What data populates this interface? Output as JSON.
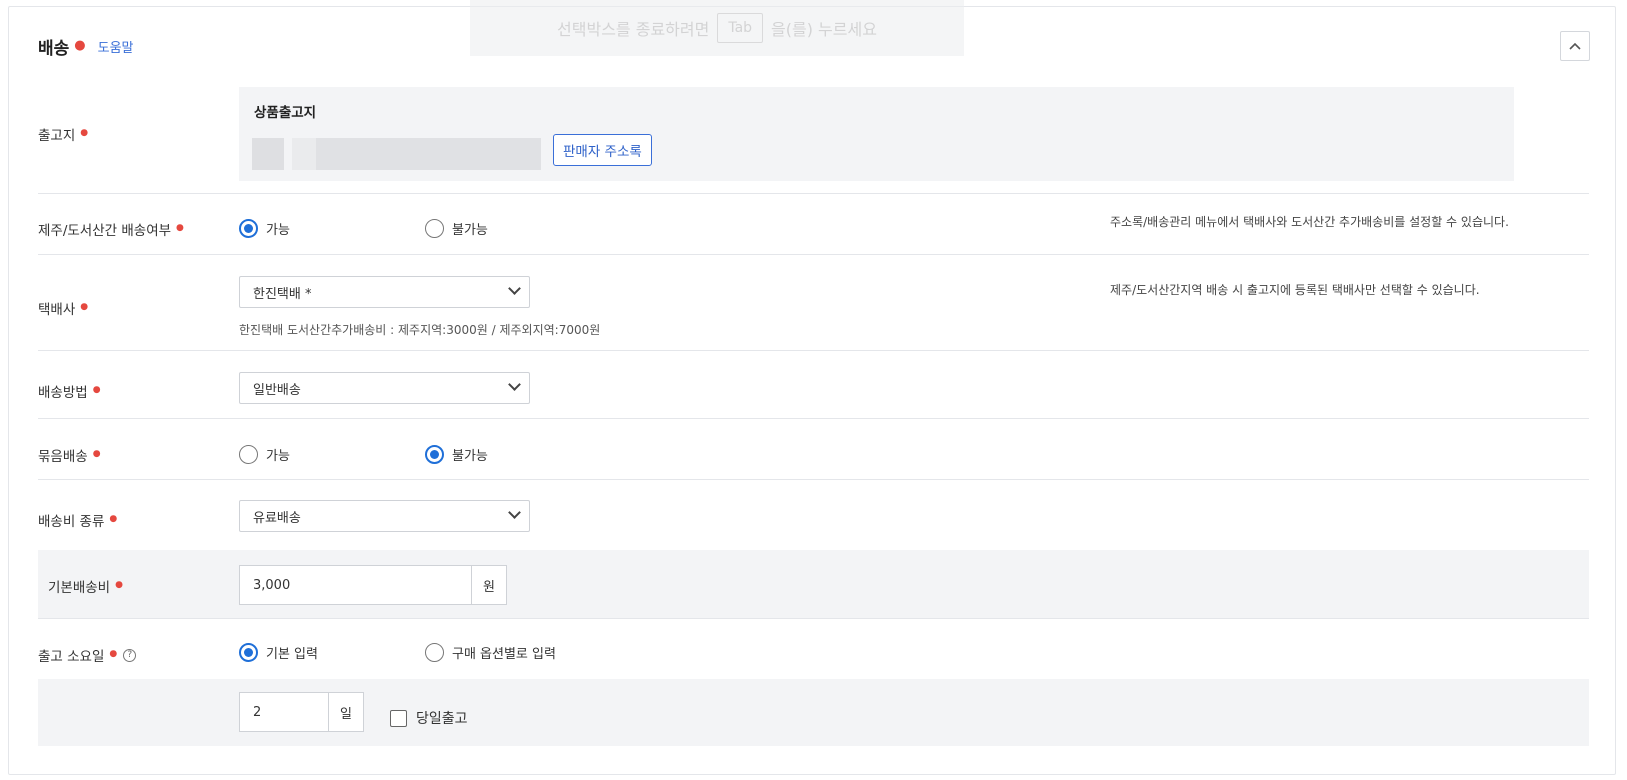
{
  "section": {
    "title": "배송",
    "help_label": "도움말",
    "collapse_icon": "chevron-up-icon"
  },
  "toast": {
    "text_before": "선택박스를 종료하려면",
    "key": "Tab",
    "text_after": "을(를) 누르세요"
  },
  "origin": {
    "label": "출고지",
    "box_title": "상품출고지",
    "address_book_button": "판매자 주소록"
  },
  "island_shipping": {
    "label": "제주/도서산간 배송여부",
    "options": [
      "가능",
      "불가능"
    ],
    "selected": "가능",
    "note": "주소록/배송관리 메뉴에서 택배사와 도서산간 추가배송비를 설정할 수 있습니다."
  },
  "courier": {
    "label": "택배사",
    "value": "한진택배 *",
    "subtext": "한진택배 도서산간추가배송비 : 제주지역:3000원 / 제주외지역:7000원",
    "note": "제주/도서산간지역 배송 시 출고지에 등록된 택배사만 선택할 수 있습니다."
  },
  "delivery_method": {
    "label": "배송방법",
    "value": "일반배송"
  },
  "bundle_shipping": {
    "label": "묶음배송",
    "options": [
      "가능",
      "불가능"
    ],
    "selected": "불가능"
  },
  "fee_type": {
    "label": "배송비 종류",
    "value": "유료배송"
  },
  "base_fee": {
    "label": "기본배송비",
    "value": "3,000",
    "unit": "원"
  },
  "lead_time": {
    "label": "출고 소요일",
    "help_icon": "question-circle-icon",
    "help_glyph": "?",
    "options": [
      "기본 입력",
      "구매 옵션별로 입력"
    ],
    "selected": "기본 입력",
    "days_value": "2",
    "days_unit": "일",
    "same_day_label": "당일출고",
    "same_day_checked": false
  },
  "colors": {
    "accent": "#1f6fd8",
    "required_dot": "#e5483f",
    "link": "#3a6fd8",
    "gray_bg": "#f3f4f6"
  }
}
